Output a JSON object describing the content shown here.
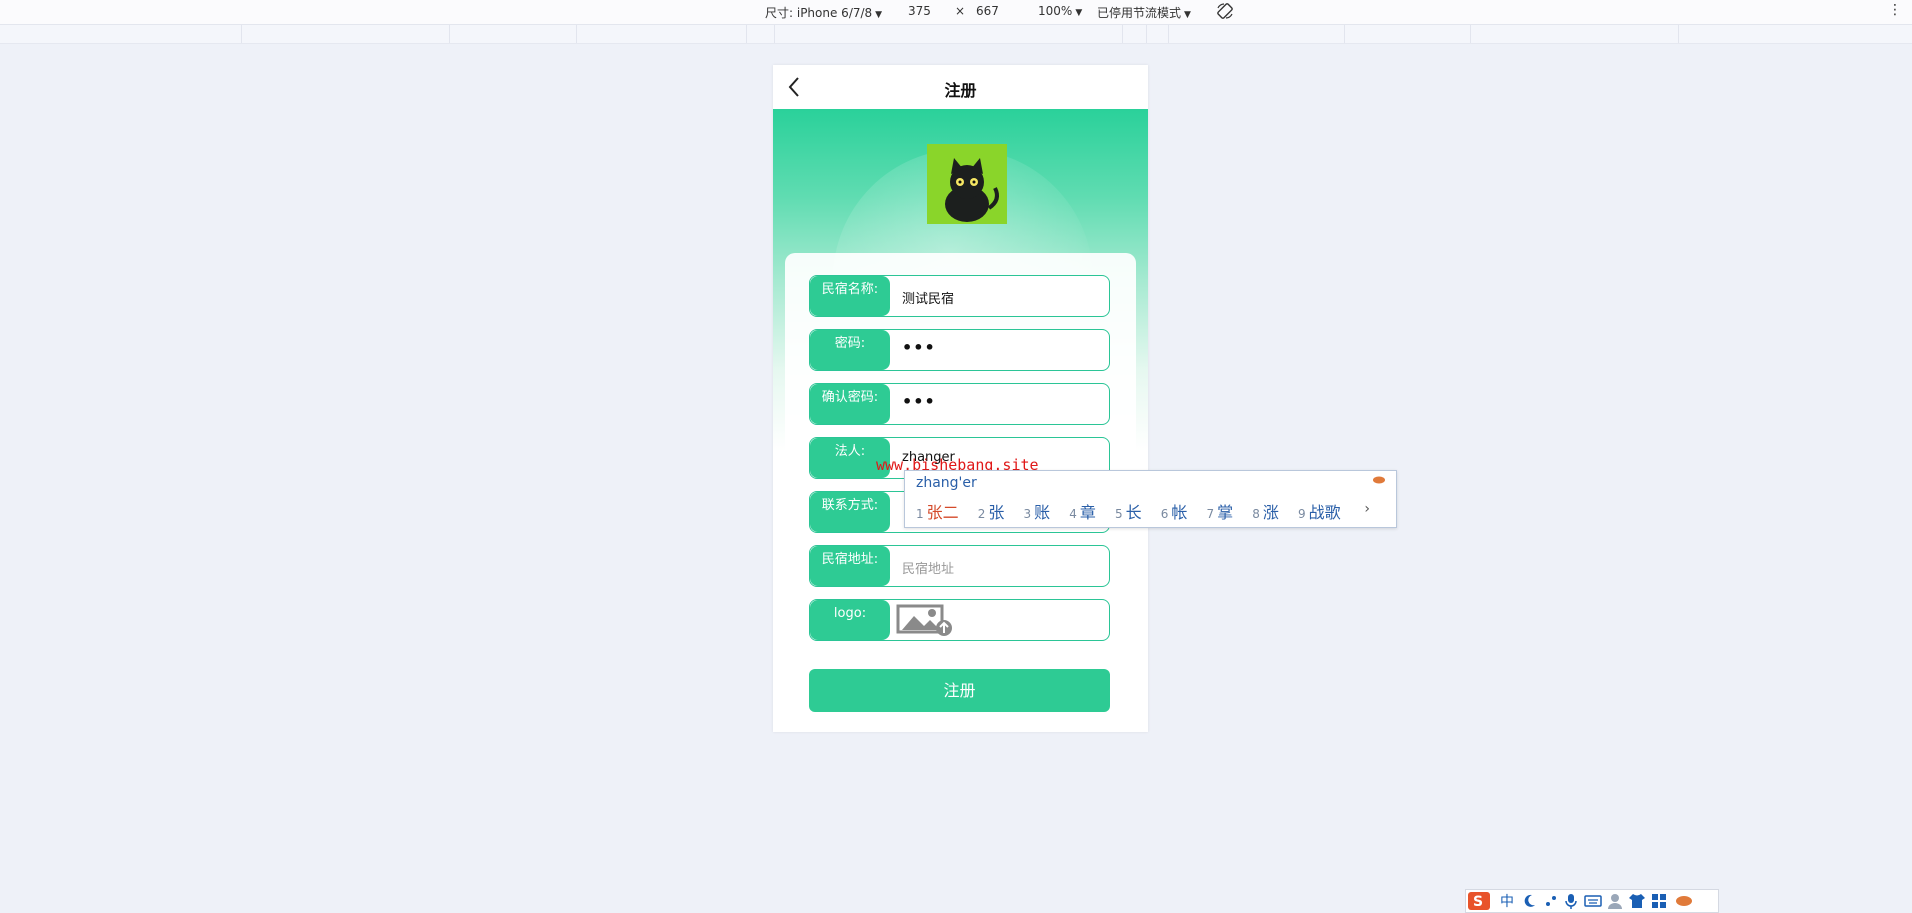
{
  "devtools": {
    "device_label": "尺寸: iPhone 6/7/8",
    "width": "375",
    "times": "×",
    "height": "667",
    "zoom": "100%",
    "throttle": "已停用节流模式"
  },
  "page": {
    "title": "注册",
    "fields": [
      {
        "label": "民宿名称:",
        "value": "测试民宿"
      },
      {
        "label": "密码:",
        "value": "•••"
      },
      {
        "label": "确认密码:",
        "value": "•••"
      },
      {
        "label": "法人:",
        "value": "zhanger"
      },
      {
        "label": "联系方式:",
        "value": ""
      },
      {
        "label": "民宿地址:",
        "placeholder": "民宿地址"
      },
      {
        "label": "logo:"
      }
    ],
    "submit_label": "注册"
  },
  "ime": {
    "pinyin": "zhang'er",
    "candidates": [
      {
        "n": "1",
        "text": "张二"
      },
      {
        "n": "2",
        "text": "张"
      },
      {
        "n": "3",
        "text": "账"
      },
      {
        "n": "4",
        "text": "章"
      },
      {
        "n": "5",
        "text": "长"
      },
      {
        "n": "6",
        "text": "帐"
      },
      {
        "n": "7",
        "text": "掌"
      },
      {
        "n": "8",
        "text": "涨"
      },
      {
        "n": "9",
        "text": "战歌"
      }
    ],
    "more": "›",
    "tray_lang": "中"
  },
  "watermark": "www.bishebang.site",
  "colors": {
    "accent": "#2ecb94",
    "ime_text": "#2a5fa8",
    "ime_selected": "#d44a2a",
    "watermark": "#e01818"
  }
}
